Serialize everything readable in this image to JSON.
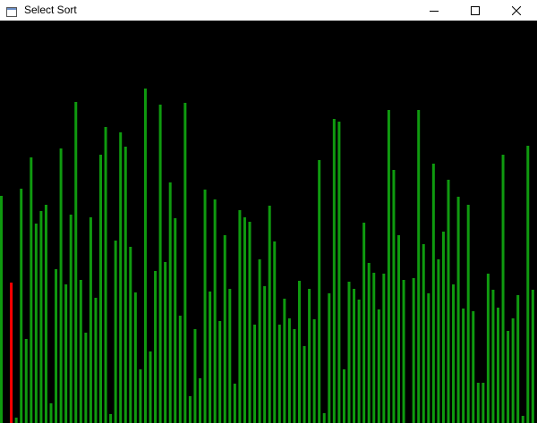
{
  "window": {
    "title": "Select Sort",
    "icon": "app-window-icon",
    "controls": [
      {
        "name": "minimize-button",
        "icon": "minimize-icon"
      },
      {
        "name": "maximize-button",
        "icon": "maximize-icon"
      },
      {
        "name": "close-button",
        "icon": "close-icon"
      }
    ]
  },
  "visualization": {
    "background_color": "#000000",
    "bar_color": "#0f9a0f",
    "active_bar_color": "#ff0000",
    "active_index": 2,
    "max_value": 450,
    "bars": [
      254,
      0,
      157,
      6,
      262,
      94,
      297,
      223,
      237,
      244,
      22,
      172,
      307,
      155,
      233,
      359,
      160,
      101,
      230,
      140,
      300,
      331,
      10,
      204,
      325,
      309,
      197,
      146,
      60,
      374,
      80,
      170,
      356,
      180,
      269,
      229,
      120,
      358,
      30,
      105,
      50,
      261,
      147,
      250,
      114,
      210,
      150,
      44,
      238,
      230,
      225,
      110,
      183,
      153,
      243,
      203,
      110,
      139,
      117,
      105,
      159,
      86,
      150,
      116,
      294,
      11,
      145,
      340,
      337,
      60,
      158,
      150,
      138,
      224,
      179,
      168,
      127,
      167,
      350,
      283,
      210,
      160,
      0,
      162,
      350,
      200,
      145,
      290,
      183,
      214,
      272,
      155,
      253,
      128,
      244,
      125,
      45,
      45,
      167,
      149,
      129,
      300,
      103,
      117,
      143,
      8,
      310,
      149
    ]
  }
}
